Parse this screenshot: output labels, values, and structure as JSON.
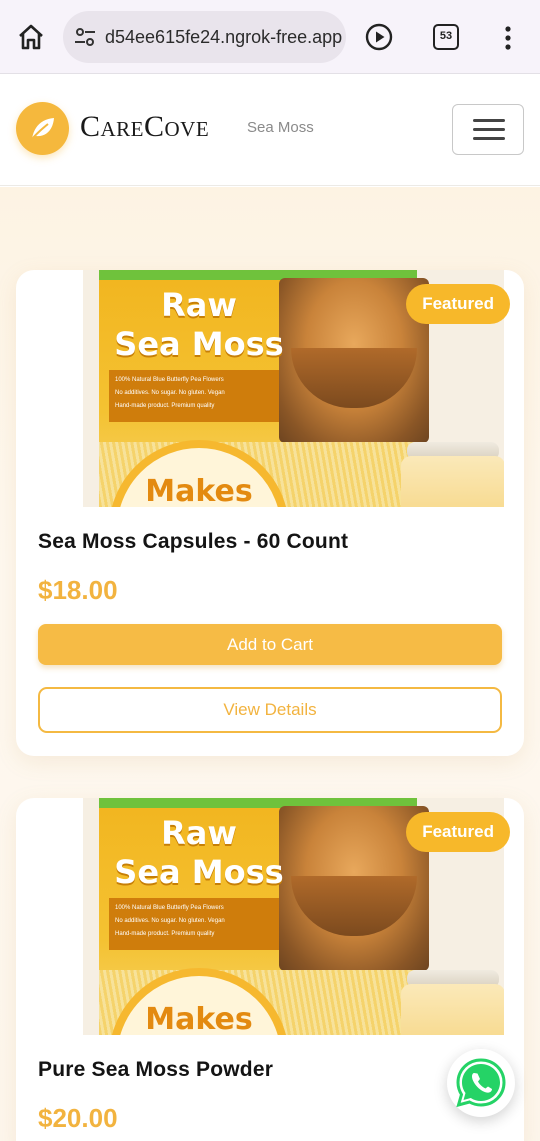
{
  "browser": {
    "url": "d54ee615fe24.ngrok-free.app",
    "tab_count": "53"
  },
  "header": {
    "brand": "CareCove",
    "brand_sub": "Sea Moss",
    "accent_color": "#f5b83d"
  },
  "package_art": {
    "title_line1": "Raw",
    "title_line2": "Sea Moss",
    "info_lines": [
      "100% Natural Blue Butterfly Pea Flowers",
      "No additives. No sugar. No gluten. Vegan",
      "Hand-made product. Premium quality"
    ],
    "makes": "Makes"
  },
  "products": [
    {
      "badge": "Featured",
      "name": "Sea Moss Capsules - 60 Count",
      "price": "$18.00",
      "add_label": "Add to Cart",
      "view_label": "View Details"
    },
    {
      "badge": "Featured",
      "name": "Pure Sea Moss Powder",
      "price": "$20.00"
    }
  ],
  "icons": {
    "home": "home-icon",
    "site_info": "tune-icon",
    "play": "play-circle-icon",
    "tabs": "tab-switcher-icon",
    "menu": "kebab-menu-icon",
    "logo": "leaf-icon",
    "nav": "hamburger-icon",
    "chat": "whatsapp-icon"
  }
}
